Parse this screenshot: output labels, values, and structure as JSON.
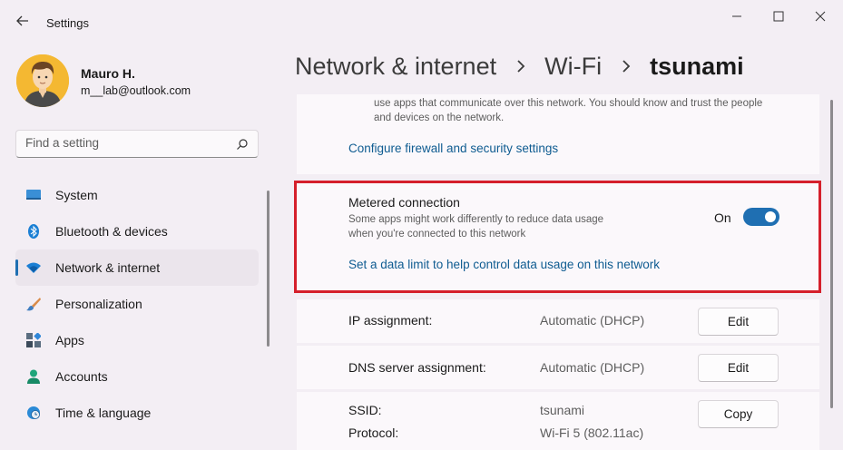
{
  "window": {
    "title": "Settings",
    "controls": [
      "minimize-icon",
      "maximize-icon",
      "close-icon"
    ]
  },
  "profile": {
    "name": "Mauro H.",
    "email": "m__lab@outlook.com"
  },
  "search": {
    "placeholder": "Find a setting",
    "value": ""
  },
  "sidebar": {
    "items": [
      {
        "label": "System",
        "icon": "monitor-icon",
        "active": false
      },
      {
        "label": "Bluetooth & devices",
        "icon": "bluetooth-icon",
        "active": false
      },
      {
        "label": "Network & internet",
        "icon": "wifi-icon",
        "active": true
      },
      {
        "label": "Personalization",
        "icon": "brush-icon",
        "active": false
      },
      {
        "label": "Apps",
        "icon": "apps-icon",
        "active": false
      },
      {
        "label": "Accounts",
        "icon": "person-icon",
        "active": false
      },
      {
        "label": "Time & language",
        "icon": "globe-clock-icon",
        "active": false
      }
    ]
  },
  "breadcrumb": {
    "items": [
      "Network & internet",
      "Wi-Fi"
    ],
    "current": "tsunami"
  },
  "firewall": {
    "description": "use apps that communicate over this network. You should know and trust the people and devices on the network.",
    "link": "Configure firewall and security settings"
  },
  "metered": {
    "title": "Metered connection",
    "description": "Some apps might work differently to reduce data usage when you're connected to this network",
    "toggle_label": "On",
    "toggle_on": true,
    "link": "Set a data limit to help control data usage on this network"
  },
  "properties": {
    "ip": {
      "label": "IP assignment:",
      "value": "Automatic (DHCP)",
      "button": "Edit"
    },
    "dns": {
      "label": "DNS server assignment:",
      "value": "Automatic (DHCP)",
      "button": "Edit"
    },
    "ssid": {
      "label": "SSID:",
      "value": "tsunami",
      "button": "Copy"
    },
    "protocol": {
      "label": "Protocol:",
      "value": "Wi-Fi 5 (802.11ac)"
    }
  },
  "colors": {
    "accent": "#1f6fb2",
    "link": "#0f5c91",
    "highlight_outline": "#d51f2b",
    "background": "#f3eef4"
  }
}
